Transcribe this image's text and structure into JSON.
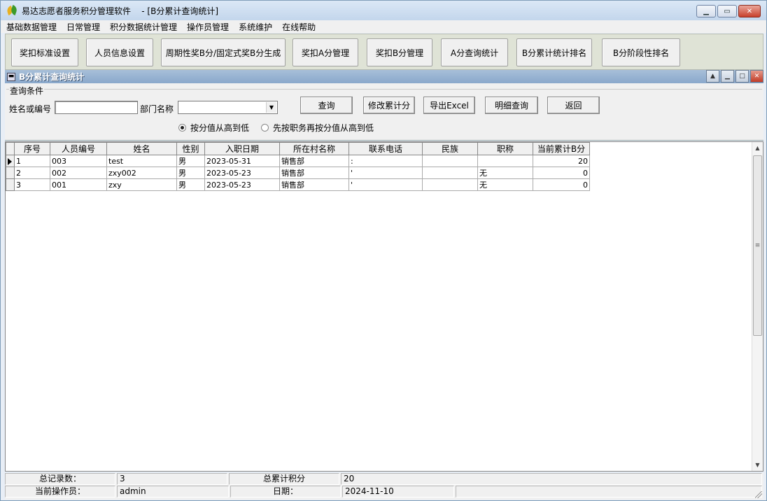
{
  "window": {
    "title": "易达志愿者服务积分管理软件    - [B分累计查询统计]",
    "controls": [
      "minimize-icon",
      "maximize-icon",
      "close-icon"
    ]
  },
  "menu": [
    "基础数据管理",
    "日常管理",
    "积分数据统计管理",
    "操作员管理",
    "系统维护",
    "在线帮助"
  ],
  "toolbar": [
    "奖扣标准设置",
    "人员信息设置",
    "周期性奖B分/固定式奖B分生成",
    "奖扣A分管理",
    "奖扣B分管理",
    "A分查询统计",
    "B分累计统计排名",
    "B分阶段性排名"
  ],
  "child": {
    "title": "B分累计查询统计"
  },
  "query": {
    "legend": "查询条件",
    "name_label": "姓名或编号",
    "name_value": "",
    "dept_label": "部门名称",
    "dept_value": "",
    "buttons": [
      "查询",
      "修改累计分",
      "导出Excel",
      "明细查询",
      "返回"
    ],
    "radios": [
      {
        "label": "按分值从高到低",
        "checked": true
      },
      {
        "label": "先按职务再按分值从高到低",
        "checked": false
      }
    ]
  },
  "table": {
    "columns": [
      "序号",
      "人员编号",
      "姓名",
      "性别",
      "入职日期",
      "所在村名称",
      "联系电话",
      "民族",
      "职称",
      "当前累计B分"
    ],
    "rows": [
      [
        "1",
        "003",
        "test",
        "男",
        "2023-05-31",
        "销售部",
        ":",
        "",
        "",
        "20"
      ],
      [
        "2",
        "002",
        "zxy002",
        "男",
        "2023-05-23",
        "销售部",
        "'",
        "",
        "无",
        "0"
      ],
      [
        "3",
        "001",
        "zxy",
        "男",
        "2023-05-23",
        "销售部",
        "'",
        "",
        "无",
        "0"
      ]
    ]
  },
  "footer": {
    "total_records_label": "总记录数：",
    "total_records_value": "3",
    "total_score_label": "总累计积分",
    "total_score_value": "20",
    "operator_label": "当前操作员：",
    "operator_value": "admin",
    "date_label": "日期：",
    "date_value": "2024-11-10"
  }
}
